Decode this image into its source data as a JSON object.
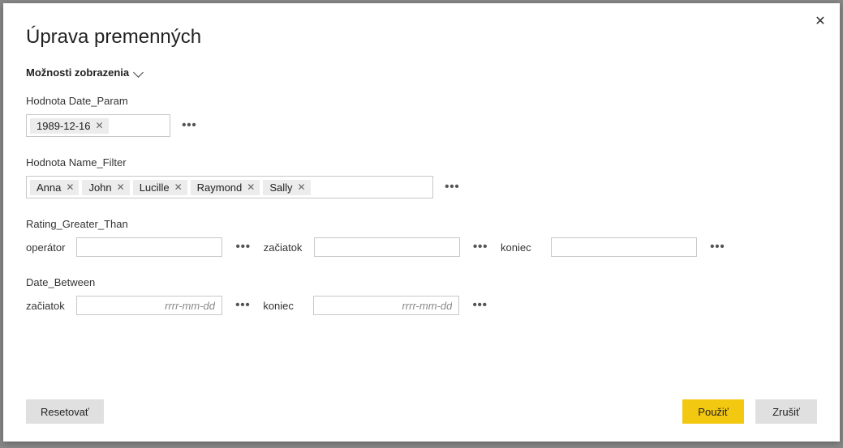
{
  "dialog": {
    "title": "Úprava premenných",
    "display_options_label": "Možnosti zobrazenia"
  },
  "groups": {
    "date_param": {
      "label": "Hodnota Date_Param",
      "tokens": [
        "1989-12-16"
      ]
    },
    "name_filter": {
      "label": "Hodnota Name_Filter",
      "tokens": [
        "Anna",
        "John",
        "Lucille",
        "Raymond",
        "Sally"
      ]
    },
    "rating_greater_than": {
      "label": "Rating_Greater_Than",
      "operator_label": "operátor",
      "start_label": "začiatok",
      "end_label": "koniec",
      "operator_value": "",
      "start_value": "",
      "end_value": ""
    },
    "date_between": {
      "label": "Date_Between",
      "start_label": "začiatok",
      "end_label": "koniec",
      "start_placeholder": "rrrr-mm-dd",
      "end_placeholder": "rrrr-mm-dd",
      "start_value": "",
      "end_value": ""
    }
  },
  "footer": {
    "reset_label": "Resetovať",
    "apply_label": "Použiť",
    "cancel_label": "Zrušiť"
  },
  "glyphs": {
    "ellipsis": "•••",
    "close": "✕",
    "token_x": "✕"
  }
}
